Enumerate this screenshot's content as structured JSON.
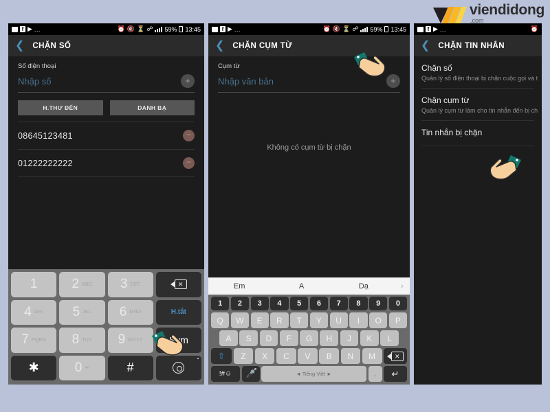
{
  "brand": {
    "name": "viendidong",
    "suffix": ".com"
  },
  "statusbar": {
    "battery": "59%",
    "time": "13:45",
    "left_icons": [
      "message-icon",
      "facebook-icon",
      "flag-icon",
      "more-dots-icon"
    ],
    "right_icons": [
      "alarm-icon",
      "mute-icon",
      "alarm-clock-icon",
      "wifi-icon",
      "signal-icon",
      "battery-icon"
    ]
  },
  "panel1": {
    "title": "CHẶN SỐ",
    "back_icon": "back-chevron-icon",
    "field_label": "Số điện thoại",
    "field_placeholder": "Nhập số",
    "add_icon": "+",
    "buttons": [
      {
        "label": "H.THƯ ĐẾN"
      },
      {
        "label": "DANH BẠ"
      }
    ],
    "blocked_numbers": [
      {
        "number": "08645123481",
        "remove_icon": "−"
      },
      {
        "number": "01222222222",
        "remove_icon": "−"
      }
    ],
    "dialpad": [
      {
        "key": "1",
        "sub": "",
        "type": "light"
      },
      {
        "key": "2",
        "sub": "ABC",
        "type": "light"
      },
      {
        "key": "3",
        "sub": "DEF",
        "type": "light"
      },
      {
        "key": "backspace",
        "sub": "",
        "type": "dark",
        "icon": "backspace-icon"
      },
      {
        "key": "4",
        "sub": "GHI",
        "type": "light"
      },
      {
        "key": "5",
        "sub": "JKL",
        "type": "light"
      },
      {
        "key": "6",
        "sub": "MNO",
        "type": "light"
      },
      {
        "key": "H.tắt",
        "sub": "",
        "type": "dark",
        "style": "word"
      },
      {
        "key": "7",
        "sub": "PQRS",
        "type": "light"
      },
      {
        "key": "8",
        "sub": "TUV",
        "type": "light"
      },
      {
        "key": "9",
        "sub": "WXYZ",
        "type": "light"
      },
      {
        "key": "Sym",
        "sub": "",
        "type": "dark",
        "style": "sym"
      },
      {
        "key": "✱",
        "sub": "",
        "type": "dark",
        "style": "star"
      },
      {
        "key": "0",
        "sub": "+",
        "type": "light"
      },
      {
        "key": "#",
        "sub": "",
        "type": "dark",
        "style": "star"
      },
      {
        "key": "gear",
        "sub": "",
        "type": "dark",
        "icon": "gear-icon"
      }
    ]
  },
  "panel2": {
    "title": "CHẶN CỤM TỪ",
    "back_icon": "back-chevron-icon",
    "field_label": "Cụm từ",
    "field_placeholder": "Nhập văn bản",
    "add_icon": "+",
    "empty_message": "Không có cụm từ bị chặn",
    "suggestions": [
      "Em",
      "A",
      "Dạ"
    ],
    "suggestion_more_icon": "›",
    "keyboard": {
      "numbers": [
        "1",
        "2",
        "3",
        "4",
        "5",
        "6",
        "7",
        "8",
        "9",
        "0"
      ],
      "row1": [
        "Q",
        "W",
        "E",
        "R",
        "T",
        "Y",
        "U",
        "I",
        "O",
        "P"
      ],
      "row2": [
        "A",
        "S",
        "D",
        "F",
        "G",
        "H",
        "J",
        "K",
        "L"
      ],
      "row3": [
        "Z",
        "X",
        "C",
        "V",
        "B",
        "N",
        "M"
      ],
      "shift_icon": "shift-up-icon",
      "backspace_icon": "backspace-icon",
      "symbols_label": "!#☺",
      "mic_icon": "microphone-icon",
      "space_label": "◄ Tiếng Việt ►",
      "period_label": ".",
      "enter_icon": "enter-return-icon"
    }
  },
  "panel3": {
    "title": "CHẶN TIN NHẮN",
    "back_icon": "back-chevron-icon",
    "items": [
      {
        "title": "Chặn số",
        "desc": "Quản lý số điện thoại bị chặn cuộc gọi và t"
      },
      {
        "title": "Chặn cụm từ",
        "desc": "Quản lý cụm từ làm cho tin nhắn đến bị ch"
      },
      {
        "title": "Tin nhắn bị chặn",
        "desc": ""
      }
    ]
  },
  "colors": {
    "background": "#b9c2d9",
    "panel_bg": "#1c1c1c",
    "appbar_bg": "#2b2b2b",
    "accent_blue": "#4a90b8",
    "keypad_bg": "#6a6a6a",
    "hand_sleeve": "#1a8c7a",
    "hand_skin": "#f5cf9a"
  }
}
